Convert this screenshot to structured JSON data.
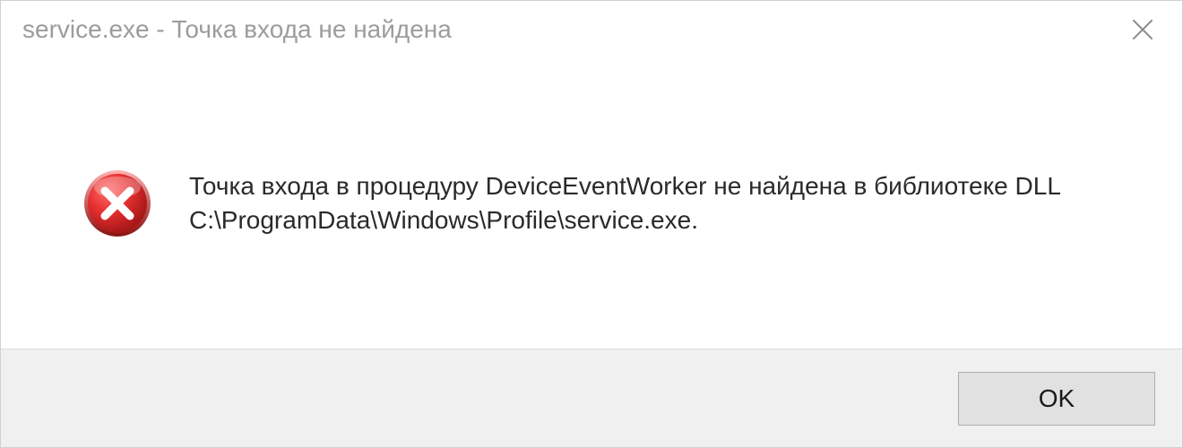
{
  "titlebar": {
    "title": "service.exe - Точка входа не найдена"
  },
  "message": {
    "text": "Точка входа в процедуру DeviceEventWorker не найдена в библиотеке DLL C:\\ProgramData\\Windows\\Profile\\service.exe."
  },
  "buttons": {
    "ok_label": "OK"
  }
}
